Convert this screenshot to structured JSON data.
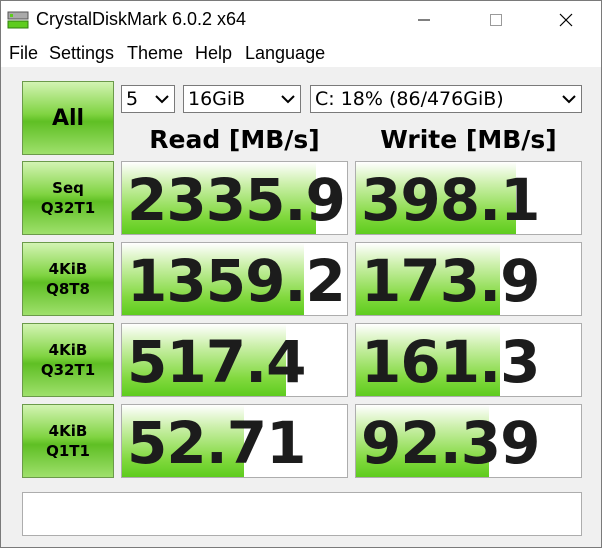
{
  "window": {
    "title": "CrystalDiskMark 6.0.2 x64",
    "controls": {
      "minimize": "—",
      "maximize": "☐",
      "close": "✕"
    }
  },
  "menu": [
    "File",
    "Settings",
    "Theme",
    "Help",
    "Language"
  ],
  "controls": {
    "all_label": "All",
    "count": "5",
    "size": "16GiB",
    "drive": "C: 18% (86/476GiB)"
  },
  "headers": {
    "read": "Read [MB/s]",
    "write": "Write [MB/s]"
  },
  "tests": [
    {
      "line1": "Seq",
      "line2": "Q32T1",
      "read": "2335.9",
      "read_level": 0.86,
      "write": "398.1",
      "write_level": 0.71
    },
    {
      "line1": "4KiB",
      "line2": "Q8T8",
      "read": "1359.2",
      "read_level": 0.81,
      "write": "173.9",
      "write_level": 0.64
    },
    {
      "line1": "4KiB",
      "line2": "Q32T1",
      "read": "517.4",
      "read_level": 0.73,
      "write": "161.3",
      "write_level": 0.64
    },
    {
      "line1": "4KiB",
      "line2": "Q1T1",
      "read": "52.71",
      "read_level": 0.54,
      "write": "92.39",
      "write_level": 0.59
    }
  ],
  "status_text": "",
  "colors": {
    "accent_green": "#5ecc1e",
    "button_green": "#7fd341"
  }
}
